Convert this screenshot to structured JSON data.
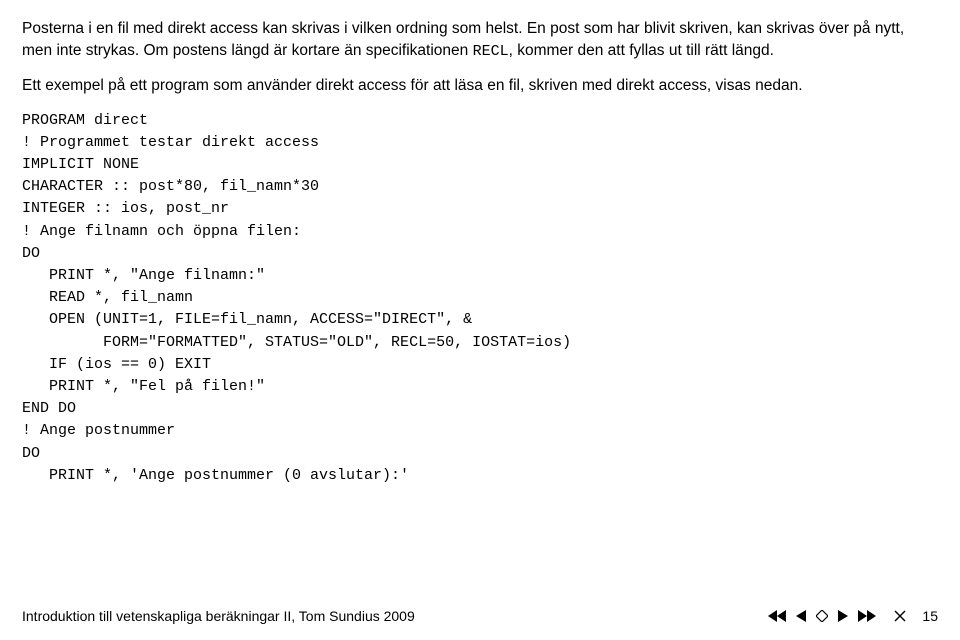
{
  "paragraphs": {
    "p1_a": "Posterna i en fil med direkt access kan skrivas i vilken ordning som helst. En post som har blivit skriven, kan skrivas över på nytt, men inte strykas. Om postens längd är kortare än specifikationen ",
    "p1_code": "RECL",
    "p1_b": ", kommer den att fyllas ut till rätt längd.",
    "p2": "Ett exempel på ett program som använder direkt access för att läsa en fil, skriven med direkt access, visas nedan."
  },
  "code": {
    "l1": "PROGRAM direct",
    "l2": "! Programmet testar direkt access",
    "l3": "IMPLICIT NONE",
    "l4": "CHARACTER :: post*80, fil_namn*30",
    "l5": "INTEGER :: ios, post_nr",
    "l6": "! Ange filnamn och öppna filen:",
    "l7": "DO",
    "l8": "   PRINT *, \"Ange filnamn:\"",
    "l9": "   READ *, fil_namn",
    "l10": "   OPEN (UNIT=1, FILE=fil_namn, ACCESS=\"DIRECT\", &",
    "l11": "         FORM=\"FORMATTED\", STATUS=\"OLD\", RECL=50, IOSTAT=ios)",
    "l12": "   IF (ios == 0) EXIT",
    "l13": "   PRINT *, \"Fel på filen!\"",
    "l14": "END DO",
    "l15": "! Ange postnummer",
    "l16": "DO",
    "l17": "   PRINT *, 'Ange postnummer (0 avslutar):'"
  },
  "footer": {
    "left": "Introduktion till vetenskapliga beräkningar II, Tom Sundius 2009",
    "pagenum": "15"
  },
  "icons": {
    "rewind": "rewind",
    "prev": "prev",
    "stop": "stop",
    "play": "play",
    "fastforward": "fastforward",
    "close": "close"
  }
}
